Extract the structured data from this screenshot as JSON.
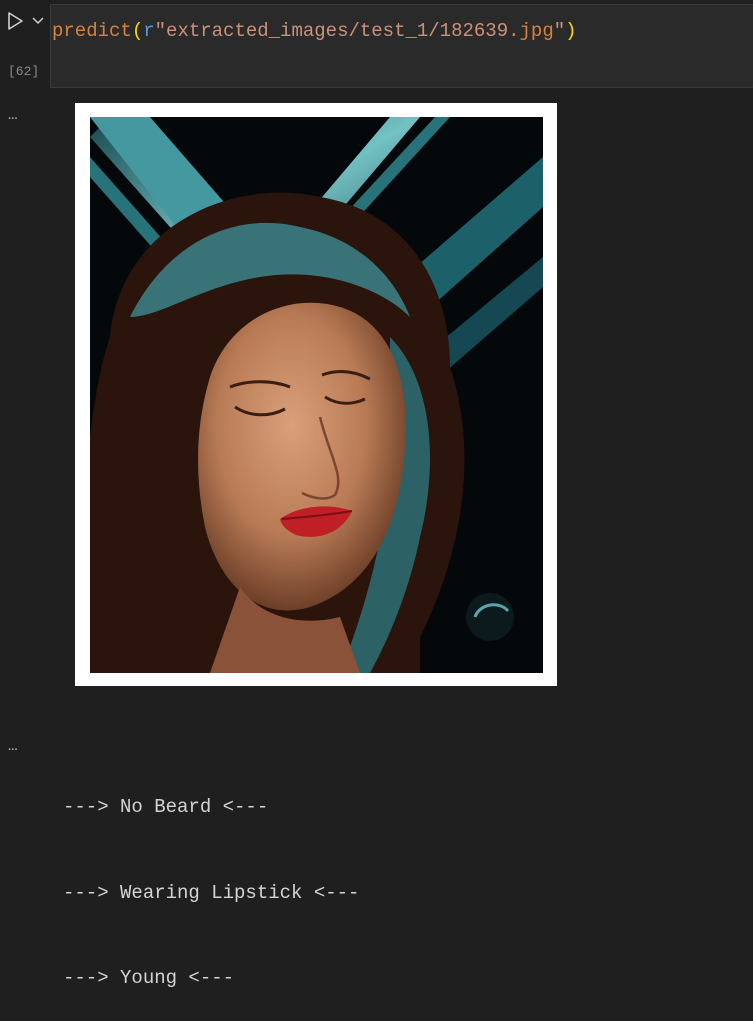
{
  "cell": {
    "execution_count": "[62]",
    "code": {
      "func": "predict",
      "open_paren": "(",
      "prefix": "r",
      "string_a": "\"extracted_images/test_1/182639",
      "string_ext": ".jpg",
      "string_close": "\"",
      "close_paren": ")"
    }
  },
  "output": {
    "more_label": "…",
    "image_alt": "woman with curly teal-lit hair and red lipstick against a dark background",
    "results": [
      "---> No Beard <---",
      "---> Wearing Lipstick <---",
      "---> Young <---"
    ]
  },
  "colors": {
    "background": "#1f1f1f",
    "editor_bg": "#2a2a2a",
    "string": "#ce9178",
    "function": "#dcdcaa"
  },
  "icons": [
    "play-icon",
    "chevron-down-icon",
    "more-icon"
  ]
}
